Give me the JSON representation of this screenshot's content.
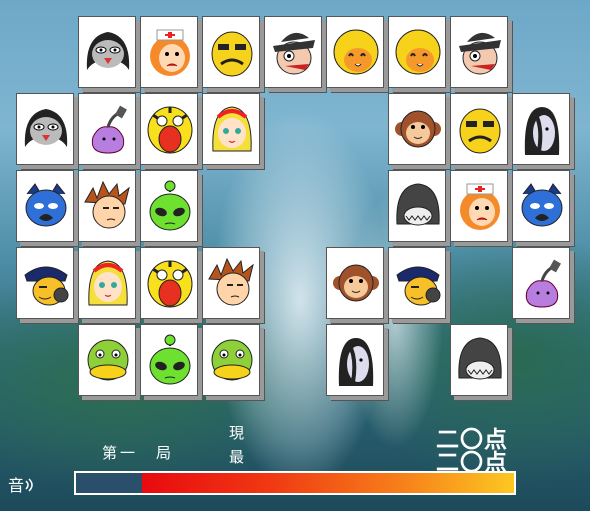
{
  "hud": {
    "current_label": "現",
    "best_label": "最",
    "round_label": "第一　局",
    "current_score": "二〇点",
    "best_score": "二〇点",
    "sound_label": "音"
  },
  "timer": {
    "remaining_fraction": 0.85
  },
  "board": {
    "tiles": [
      {
        "row": 0,
        "col": 1,
        "face": "penguin-icon"
      },
      {
        "row": 0,
        "col": 2,
        "face": "nurse-icon"
      },
      {
        "row": 0,
        "col": 3,
        "face": "bald-man-icon"
      },
      {
        "row": 0,
        "col": 4,
        "face": "hat-man-icon"
      },
      {
        "row": 0,
        "col": 5,
        "face": "yellow-girl-icon"
      },
      {
        "row": 0,
        "col": 6,
        "face": "yellow-girl-icon"
      },
      {
        "row": 0,
        "col": 7,
        "face": "hat-man-icon"
      },
      {
        "row": 1,
        "col": 0,
        "face": "penguin-icon"
      },
      {
        "row": 1,
        "col": 1,
        "face": "plug-icon"
      },
      {
        "row": 1,
        "col": 2,
        "face": "tiger-icon"
      },
      {
        "row": 1,
        "col": 3,
        "face": "blonde-girl-icon"
      },
      {
        "row": 1,
        "col": 6,
        "face": "monkey-icon"
      },
      {
        "row": 1,
        "col": 7,
        "face": "bald-man-icon"
      },
      {
        "row": 1,
        "col": 8,
        "face": "ghost-icon"
      },
      {
        "row": 2,
        "col": 0,
        "face": "blue-cat-icon"
      },
      {
        "row": 2,
        "col": 1,
        "face": "spiky-boy-icon"
      },
      {
        "row": 2,
        "col": 2,
        "face": "alien-icon"
      },
      {
        "row": 2,
        "col": 6,
        "face": "gray-blob-icon"
      },
      {
        "row": 2,
        "col": 7,
        "face": "nurse-icon"
      },
      {
        "row": 2,
        "col": 8,
        "face": "blue-cat-icon"
      },
      {
        "row": 3,
        "col": 0,
        "face": "cap-boy-icon"
      },
      {
        "row": 3,
        "col": 1,
        "face": "blonde-girl-icon"
      },
      {
        "row": 3,
        "col": 2,
        "face": "tiger-icon"
      },
      {
        "row": 3,
        "col": 3,
        "face": "spiky-boy-icon"
      },
      {
        "row": 3,
        "col": 5,
        "face": "monkey-icon"
      },
      {
        "row": 3,
        "col": 6,
        "face": "cap-boy-icon"
      },
      {
        "row": 3,
        "col": 8,
        "face": "plug-icon"
      },
      {
        "row": 4,
        "col": 1,
        "face": "duck-icon"
      },
      {
        "row": 4,
        "col": 2,
        "face": "alien-icon"
      },
      {
        "row": 4,
        "col": 3,
        "face": "duck-icon"
      },
      {
        "row": 4,
        "col": 5,
        "face": "ghost-icon"
      },
      {
        "row": 4,
        "col": 7,
        "face": "gray-blob-icon"
      }
    ]
  }
}
